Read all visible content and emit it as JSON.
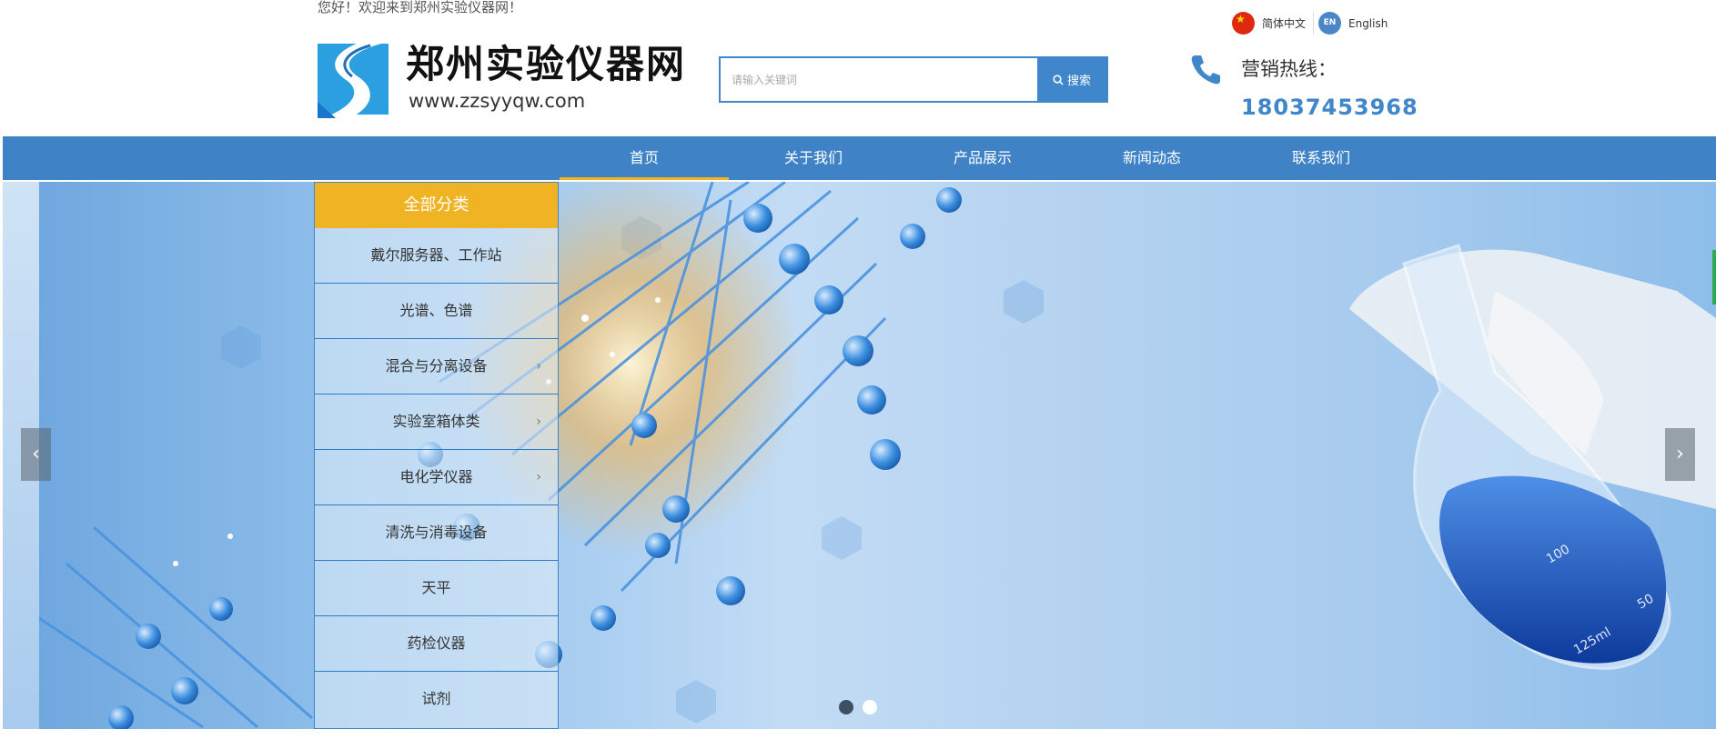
{
  "header": {
    "welcome_text": "您好！欢迎来到郑州实验仪器网！",
    "site_name": "郑州实验仪器网",
    "site_domain": "www.zzsyyqw.com",
    "lang_cn": "简体中文",
    "lang_en_badge": "EN",
    "lang_en": "English"
  },
  "search": {
    "placeholder": "请输入关键词",
    "button_label": "搜索"
  },
  "hotline": {
    "label": "营销热线：",
    "number": "18037453968"
  },
  "nav": {
    "items": [
      {
        "label": "首页"
      },
      {
        "label": "关于我们"
      },
      {
        "label": "产品展示"
      },
      {
        "label": "新闻动态"
      },
      {
        "label": "联系我们"
      }
    ],
    "active_index": 0
  },
  "category": {
    "title": "全部分类",
    "items": [
      {
        "label": "戴尔服务器、工作站",
        "has_sub": false
      },
      {
        "label": "光谱、色谱",
        "has_sub": false
      },
      {
        "label": "混合与分离设备",
        "has_sub": true
      },
      {
        "label": "实验室箱体类",
        "has_sub": true
      },
      {
        "label": "电化学仪器",
        "has_sub": true
      },
      {
        "label": "清洗与消毒设备",
        "has_sub": false
      },
      {
        "label": "天平",
        "has_sub": false
      },
      {
        "label": "药检仪器",
        "has_sub": false
      },
      {
        "label": "试剂",
        "has_sub": false
      }
    ],
    "chevron": "›"
  },
  "banner": {
    "arrow_left": "‹",
    "arrow_right": "›",
    "slide_count": 2,
    "active_slide": 0
  },
  "colors": {
    "primary": "#3f86cb",
    "accent": "#f0b323",
    "nav_bg": "#3f82c6"
  },
  "icons": {
    "search": "search-icon",
    "phone": "phone-icon",
    "flag": "china-flag-icon"
  }
}
